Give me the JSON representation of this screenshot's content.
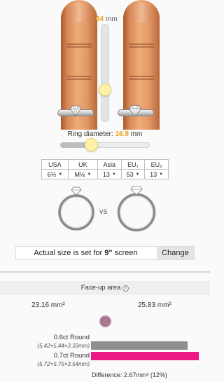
{
  "finger_slider": {
    "value": "64",
    "unit": "mm"
  },
  "ring_diameter": {
    "label": "Ring diameter:",
    "value": "16.9",
    "unit": "mm",
    "slider_position": 0.33
  },
  "size_table": {
    "headers": [
      "USA",
      "UK",
      "Asia",
      "EU₁",
      "EU₂"
    ],
    "values": [
      "6½",
      "M½",
      "13",
      "53",
      "13"
    ]
  },
  "comparison": {
    "vs_label": "VS"
  },
  "actual_size": {
    "text_prefix": "Actual size is set for ",
    "screen": "9\"",
    "text_suffix": " screen",
    "change_label": "Change"
  },
  "face_up": {
    "title": "Face-up area",
    "info_icon": "info-icon",
    "area_left": "23.16 mm²",
    "area_right": "25.83 mm²",
    "stones": [
      {
        "name": "0.6ct Round",
        "dims": "(5.42×5.44×3.33mm)",
        "color": "#8f8f8f",
        "area": 23.16
      },
      {
        "name": "0.7ct Round",
        "dims": "(5.72×5.75×3.54mm)",
        "color": "#ec1985",
        "area": 25.83
      }
    ],
    "difference": "Difference: 2.67mm² (12%)"
  }
}
